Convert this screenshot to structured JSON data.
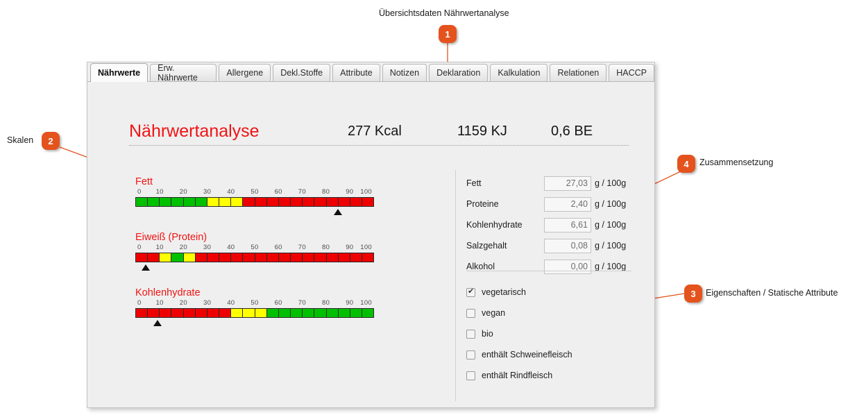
{
  "annotations": {
    "accent_color": "#E4531D",
    "items": [
      {
        "number": "1",
        "label": "Übersichtsdaten Nährwertanalyse"
      },
      {
        "number": "2",
        "label": "Skalen"
      },
      {
        "number": "3",
        "label": "Eigenschaften / Statische Attribute"
      },
      {
        "number": "4",
        "label": "Zusammensetzung"
      }
    ]
  },
  "tabs": [
    {
      "label": "Nährwerte",
      "active": true
    },
    {
      "label": "Erw. Nährwerte",
      "active": false
    },
    {
      "label": "Allergene",
      "active": false
    },
    {
      "label": "Dekl.Stoffe",
      "active": false
    },
    {
      "label": "Attribute",
      "active": false
    },
    {
      "label": "Notizen",
      "active": false
    },
    {
      "label": "Deklaration",
      "active": false
    },
    {
      "label": "Kalkulation",
      "active": false
    },
    {
      "label": "Relationen",
      "active": false
    },
    {
      "label": "HACCP",
      "active": false
    }
  ],
  "header": {
    "title": "Nährwertanalyse",
    "title_color": "#f01414",
    "kcal": "277 Kcal",
    "kj": "1159 KJ",
    "be": "0,6 BE"
  },
  "chart_data": {
    "type": "bar",
    "title": "Nährwertanalyse",
    "xlabel": "",
    "ylabel": "",
    "xlim": [
      0,
      100
    ],
    "tick_labels": [
      "0",
      "10",
      "20",
      "30",
      "40",
      "50",
      "60",
      "70",
      "80",
      "90",
      "100"
    ],
    "segment_count": 20,
    "segment_size": 5,
    "colors": {
      "green": "#00c000",
      "yellow": "#ffff00",
      "red": "#ee0000"
    },
    "scales": [
      {
        "name": "Fett",
        "marker_value": 85,
        "segments": [
          "green",
          "green",
          "green",
          "green",
          "green",
          "green",
          "yellow",
          "yellow",
          "yellow",
          "red",
          "red",
          "red",
          "red",
          "red",
          "red",
          "red",
          "red",
          "red",
          "red",
          "red"
        ]
      },
      {
        "name": "Eiweiß (Protein)",
        "marker_value": 4,
        "segments": [
          "red",
          "red",
          "yellow",
          "green",
          "yellow",
          "red",
          "red",
          "red",
          "red",
          "red",
          "red",
          "red",
          "red",
          "red",
          "red",
          "red",
          "red",
          "red",
          "red",
          "red"
        ]
      },
      {
        "name": "Kohlenhydrate",
        "marker_value": 9,
        "segments": [
          "red",
          "red",
          "red",
          "red",
          "red",
          "red",
          "red",
          "red",
          "yellow",
          "yellow",
          "yellow",
          "green",
          "green",
          "green",
          "green",
          "green",
          "green",
          "green",
          "green",
          "green"
        ]
      }
    ]
  },
  "composition": {
    "rows": [
      {
        "label": "Fett",
        "value": "27,03",
        "unit": "g / 100g"
      },
      {
        "label": "Proteine",
        "value": "2,40",
        "unit": "g / 100g"
      },
      {
        "label": "Kohlenhydrate",
        "value": "6,61",
        "unit": "g / 100g"
      },
      {
        "label": "Salzgehalt",
        "value": "0,08",
        "unit": "g / 100g"
      },
      {
        "label": "Alkohol",
        "value": "0,00",
        "unit": "g / 100g"
      }
    ]
  },
  "properties": {
    "items": [
      {
        "label": "vegetarisch",
        "checked": true
      },
      {
        "label": "vegan",
        "checked": false
      },
      {
        "label": "bio",
        "checked": false
      },
      {
        "label": "enthält Schweinefleisch",
        "checked": false
      },
      {
        "label": "enthält Rindfleisch",
        "checked": false
      }
    ]
  }
}
